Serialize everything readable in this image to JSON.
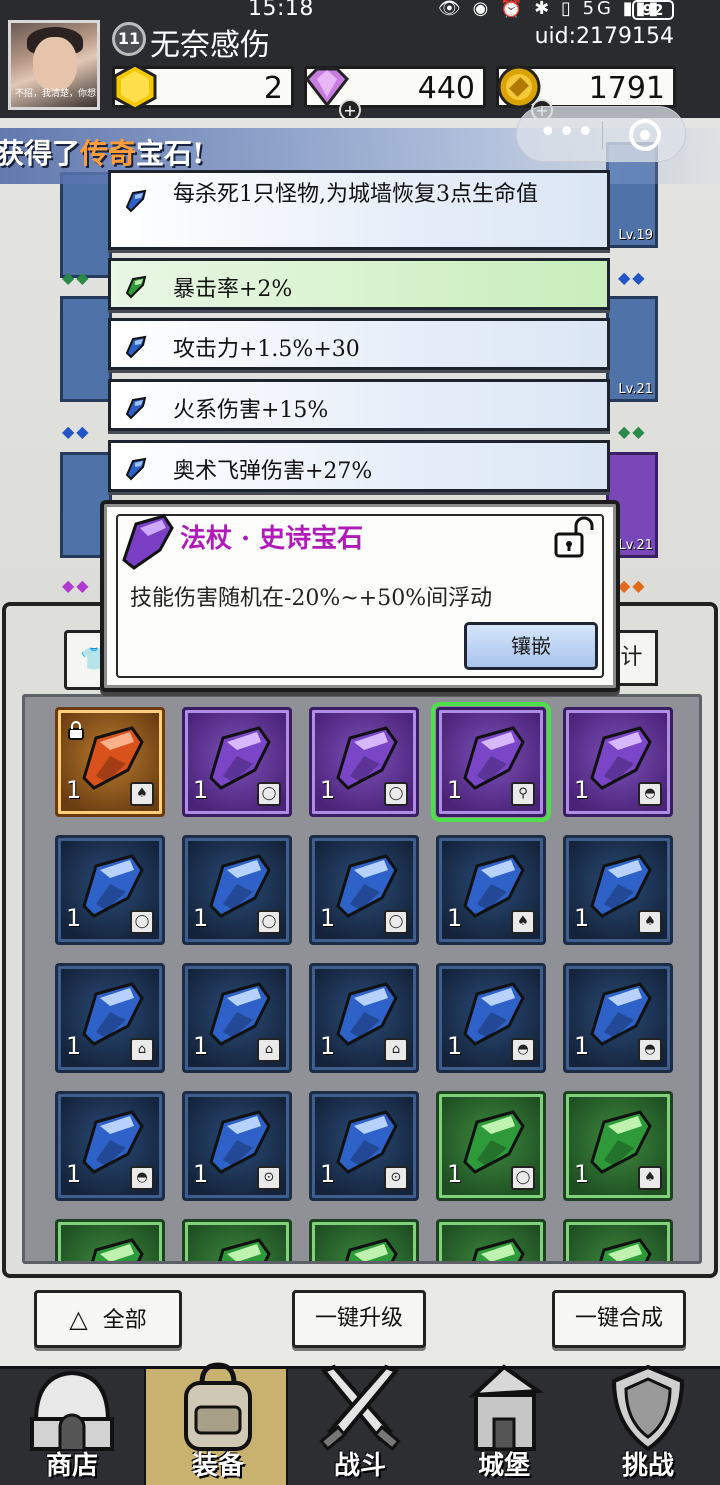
{
  "status_bar": {
    "time": "15:18",
    "icons": "👁 ◉ ⏰ ✱ ▯ 5G ▮▮▮",
    "battery": "92"
  },
  "player": {
    "avatar_caption": "不招，我清楚，你想",
    "level": "11",
    "name": "无奈感伤",
    "uid": "uid:2179154"
  },
  "resources": [
    {
      "name": "gold-hexagon",
      "value": "2",
      "color": "#f5c800"
    },
    {
      "name": "purple-diamond",
      "value": "440",
      "color": "#c77de0"
    },
    {
      "name": "gold-coin",
      "value": "1791",
      "color": "#d9a300"
    }
  ],
  "banner": {
    "prefix": "获得了",
    "highlight": "传奇",
    "suffix": "宝石!"
  },
  "equipment_levels": [
    "Lv.19",
    "Lv.21",
    "Lv.21"
  ],
  "affixes": [
    {
      "text": "每杀死1只怪物,为城墙恢复3点生命值",
      "color": "blue"
    },
    {
      "text": "暴击率+2%",
      "color": "green"
    },
    {
      "text": "攻击力+1.5%+30",
      "color": "blue"
    },
    {
      "text": "火系伤害+15%",
      "color": "blue"
    },
    {
      "text": "奥术飞弹伤害+27%",
      "color": "blue"
    }
  ],
  "tooltip": {
    "title": "法杖 · 史诗宝石",
    "description": "技能伤害随机在-20%~+50%间浮动",
    "button": "镶嵌"
  },
  "filter": {
    "right_label": "计"
  },
  "inventory": [
    {
      "rarity": "orange",
      "count": "1",
      "slot": "armor",
      "locked": true
    },
    {
      "rarity": "purple",
      "count": "1",
      "slot": "ring"
    },
    {
      "rarity": "purple",
      "count": "1",
      "slot": "ring"
    },
    {
      "rarity": "purple",
      "count": "1",
      "slot": "staff",
      "selected": true
    },
    {
      "rarity": "purple",
      "count": "1",
      "slot": "helmet"
    },
    {
      "rarity": "blue",
      "count": "1",
      "slot": "ring"
    },
    {
      "rarity": "blue",
      "count": "1",
      "slot": "ring"
    },
    {
      "rarity": "blue",
      "count": "1",
      "slot": "ring"
    },
    {
      "rarity": "blue",
      "count": "1",
      "slot": "armor"
    },
    {
      "rarity": "blue",
      "count": "1",
      "slot": "armor"
    },
    {
      "rarity": "blue",
      "count": "1",
      "slot": "boots"
    },
    {
      "rarity": "blue",
      "count": "1",
      "slot": "boots"
    },
    {
      "rarity": "blue",
      "count": "1",
      "slot": "boots"
    },
    {
      "rarity": "blue",
      "count": "1",
      "slot": "helmet"
    },
    {
      "rarity": "blue",
      "count": "1",
      "slot": "helmet"
    },
    {
      "rarity": "blue",
      "count": "1",
      "slot": "helmet"
    },
    {
      "rarity": "blue",
      "count": "1",
      "slot": "necklace"
    },
    {
      "rarity": "blue",
      "count": "1",
      "slot": "necklace"
    },
    {
      "rarity": "green",
      "count": "1",
      "slot": "ring"
    },
    {
      "rarity": "green",
      "count": "1",
      "slot": "armor"
    },
    {
      "rarity": "green",
      "count": "",
      "slot": ""
    },
    {
      "rarity": "green",
      "count": "",
      "slot": ""
    },
    {
      "rarity": "green",
      "count": "",
      "slot": ""
    },
    {
      "rarity": "green",
      "count": "",
      "slot": ""
    },
    {
      "rarity": "green",
      "count": "",
      "slot": ""
    }
  ],
  "actions": {
    "all": "全部",
    "upgrade": "一键升级",
    "merge": "一键合成"
  },
  "nav": [
    {
      "label": "商店",
      "icon": "shop-icon"
    },
    {
      "label": "装备",
      "icon": "backpack-icon",
      "active": true
    },
    {
      "label": "战斗",
      "icon": "crossed-swords-icon"
    },
    {
      "label": "城堡",
      "icon": "castle-icon"
    },
    {
      "label": "挑战",
      "icon": "shield-icon"
    }
  ]
}
